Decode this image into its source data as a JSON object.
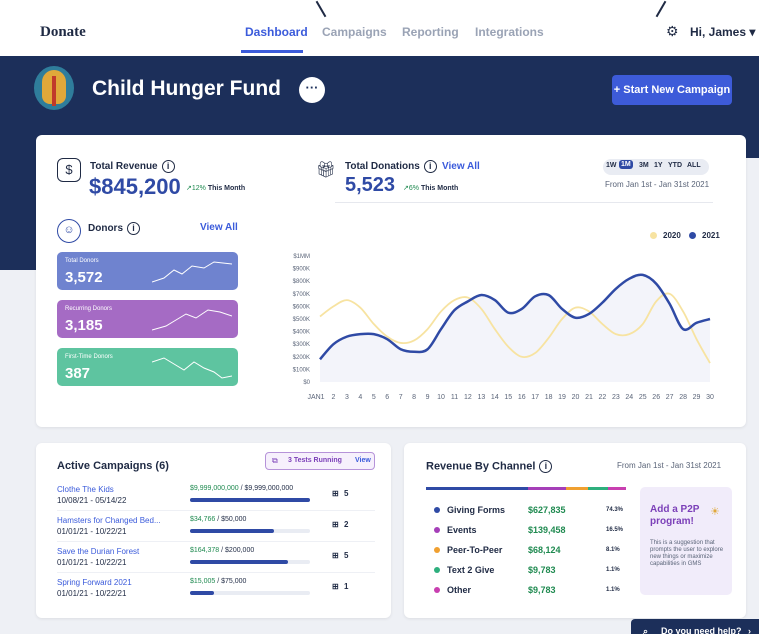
{
  "nav": {
    "logo": "Donate",
    "tabs": [
      "Dashboard",
      "Campaigns",
      "Reporting",
      "Integrations"
    ],
    "active_tab": "Dashboard",
    "greeting": "Hi, James ▾"
  },
  "hero": {
    "org_name": "Child Hunger Fund",
    "more_label": "···",
    "start_campaign_label": "+ Start New Campaign"
  },
  "summary": {
    "revenue": {
      "label": "Total Revenue",
      "value": "$845,200",
      "delta": "↗12%",
      "period": "This Month"
    },
    "donations": {
      "label": "Total Donations",
      "view_all": "View All",
      "value": "5,523",
      "delta": "↗6%",
      "period": "This Month"
    },
    "periods": [
      "1W",
      "1M",
      "3M",
      "1Y",
      "YTD",
      "ALL"
    ],
    "active_period": "1M",
    "range": "From Jan 1st - Jan 31st 2021"
  },
  "donors": {
    "label": "Donors",
    "view_all": "View All",
    "cards": [
      {
        "label": "Total Donors",
        "value": "3,572",
        "color": "#6f83cf"
      },
      {
        "label": "Recurring Donors",
        "value": "3,185",
        "color": "#a56bc4"
      },
      {
        "label": "First-Time Donors",
        "value": "387",
        "color": "#5ec4a0"
      }
    ]
  },
  "chart_data": {
    "type": "line",
    "x": [
      1,
      2,
      3,
      4,
      5,
      6,
      7,
      8,
      9,
      10,
      11,
      12,
      13,
      14,
      15,
      16,
      17,
      18,
      19,
      20,
      21,
      22,
      23,
      24,
      25,
      26,
      27,
      28,
      29,
      30
    ],
    "x_prefix": "JAN",
    "y_ticks": [
      "$1MM",
      "$900K",
      "$800K",
      "$700K",
      "$600K",
      "$500K",
      "$400K",
      "$300K",
      "$200K",
      "$100K",
      "$0"
    ],
    "ylim": [
      0,
      1000000
    ],
    "legend_position": "top-right",
    "series": [
      {
        "name": "2020",
        "color": "#f7e3a1",
        "values": [
          520000,
          600000,
          650000,
          590000,
          460000,
          360000,
          310000,
          330000,
          420000,
          560000,
          650000,
          670000,
          580000,
          420000,
          280000,
          200000,
          230000,
          350000,
          500000,
          590000,
          560000,
          460000,
          380000,
          380000,
          460000,
          640000,
          700000,
          560000,
          340000,
          150000
        ]
      },
      {
        "name": "2021",
        "color": "#2f4aa5",
        "values": [
          180000,
          300000,
          360000,
          380000,
          380000,
          340000,
          260000,
          240000,
          260000,
          420000,
          570000,
          640000,
          690000,
          650000,
          550000,
          580000,
          680000,
          690000,
          580000,
          510000,
          540000,
          630000,
          740000,
          820000,
          850000,
          780000,
          620000,
          420000,
          470000,
          500000
        ]
      }
    ]
  },
  "campaigns": {
    "title": "Active Campaigns (6)",
    "tests_label": "3 Tests Running",
    "view_label": "View",
    "rows": [
      {
        "name": "Clothe The Kids",
        "dates": "10/08/21 - 05/14/22",
        "raised": "$9,999,000,000",
        "goal": " / $9,999,000,000",
        "progress": 1.0,
        "count": "5"
      },
      {
        "name": "Hamsters for Changed Bed...",
        "dates": "01/01/21 - 10/22/21",
        "raised": "$34,766",
        "goal": " / $50,000",
        "progress": 0.7,
        "count": "2"
      },
      {
        "name": "Save the Durian Forest",
        "dates": "01/01/21 - 10/22/21",
        "raised": "$164,378",
        "goal": " / $200,000",
        "progress": 0.82,
        "count": "5"
      },
      {
        "name": "Spring Forward 2021",
        "dates": "01/01/21 - 10/22/21",
        "raised": "$15,005",
        "goal": " / $75,000",
        "progress": 0.2,
        "count": "1"
      }
    ]
  },
  "channels": {
    "title": "Revenue By Channel",
    "range": "From Jan 1st - Jan 31st 2021",
    "rows": [
      {
        "name": "Giving Forms",
        "value": "$627,835",
        "pct": "74.3%",
        "color": "#2f4aa5"
      },
      {
        "name": "Events",
        "value": "$139,458",
        "pct": "16.5%",
        "color": "#a53fb8"
      },
      {
        "name": "Peer-To-Peer",
        "value": "$68,124",
        "pct": "8.1%",
        "color": "#f0a030"
      },
      {
        "name": "Text 2 Give",
        "value": "$9,783",
        "pct": "1.1%",
        "color": "#2eaf7d"
      },
      {
        "name": "Other",
        "value": "$9,783",
        "pct": "1.1%",
        "color": "#c83fb0"
      }
    ],
    "tip_title": "Add a P2P program!",
    "tip_body": "This is a suggestion that prompts the user to explore new things or maximize capabilities in GMS"
  },
  "help": {
    "label": "Do you need help?"
  }
}
